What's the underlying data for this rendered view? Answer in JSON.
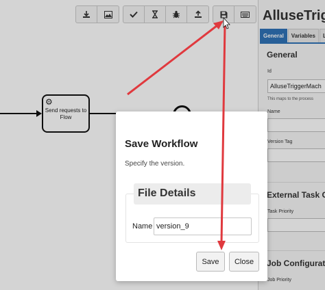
{
  "toolbar": {
    "group1": [
      "download-icon",
      "image-icon"
    ],
    "group2": [
      "check-icon",
      "hourglass-icon",
      "bug-icon",
      "upload-icon"
    ],
    "group3": [
      "save-icon",
      "keyboard-icon"
    ]
  },
  "diagram": {
    "task_label": "Send requests to Flow"
  },
  "panel": {
    "title": "AlluseTrigg",
    "tabs": [
      {
        "label": "General",
        "active": true
      },
      {
        "label": "Variables",
        "active": false
      },
      {
        "label": "L",
        "active": false
      }
    ],
    "general_heading": "General",
    "id_label": "Id",
    "id_value": "AlluseTriggerMach",
    "id_hint": "This maps to the process",
    "name_label": "Name",
    "version_tag_label": "Version Tag",
    "external_task_heading": "External Task Co",
    "task_priority_label": "Task Priority",
    "job_config_heading": "Job Configuratio",
    "job_priority_label": "Job Priority"
  },
  "modal": {
    "title": "Save Workflow",
    "subtitle": "Specify the version.",
    "fieldset_legend": "File Details",
    "name_label": "Name",
    "name_value": "version_9",
    "save_label": "Save",
    "close_label": "Close"
  },
  "colors": {
    "accent": "#2f73b7",
    "arrow": "#e0393e"
  }
}
